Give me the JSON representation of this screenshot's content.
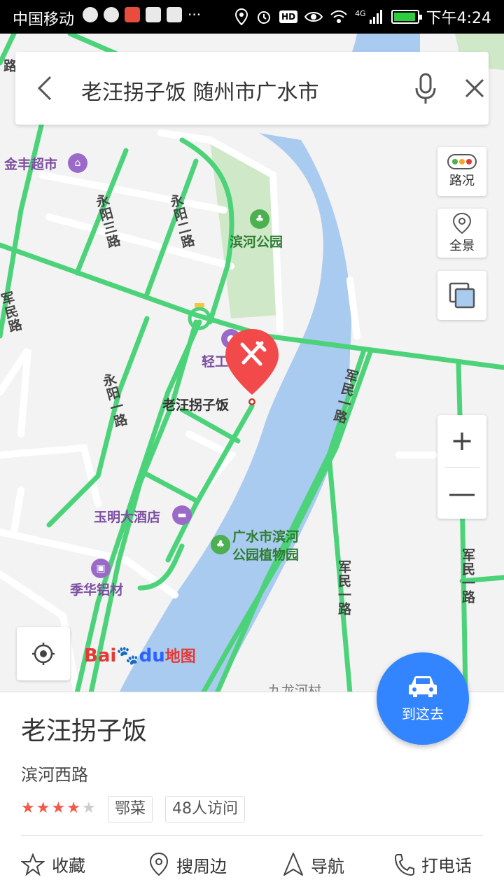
{
  "status_bar": {
    "carrier": "中国移动",
    "network": "4G",
    "hd": "HD",
    "time": "下午4:24",
    "more": "···"
  },
  "search": {
    "query": "老汪拐子饭 随州市广水市"
  },
  "map": {
    "labels": {
      "jinfeng": "金丰超市",
      "binhe_park": "滨河公园",
      "qinggong": "轻工",
      "yuming": "玉明大酒店",
      "guangshui_park_1": "广水市滨河",
      "guangshui_park_2": "公园植物园",
      "jihua": "季华铝材",
      "jiulong": "九龙河村",
      "marker_name": "老汪拐子饭"
    },
    "roads": {
      "yongyang_top": "永阳三路",
      "yongyang_2": "永阳二路",
      "yongyang_1": "永阳一路",
      "junmin_left": "军民路",
      "junmin_mid": "军民一路",
      "junmin_low": "军民一路",
      "junmin_right": "军民一路",
      "top_left": "路"
    },
    "colors": {
      "road": "#4cd37a",
      "water": "#a9cbef",
      "park": "#cfe9c8",
      "marker": "#f2494b"
    }
  },
  "controls": {
    "traffic": "路况",
    "panorama": "全景",
    "zoom_in": "+",
    "zoom_out": "—"
  },
  "logo": {
    "part1": "Bai",
    "part2": "du",
    "part3": "地图"
  },
  "go_button": {
    "label": "到这去"
  },
  "place": {
    "name": "老汪拐子饭",
    "address": "滨河西路",
    "rating": 4,
    "max_rating": 5,
    "cuisine": "鄂菜",
    "visits": "48人访问"
  },
  "actions": {
    "favorite": "收藏",
    "nearby": "搜周边",
    "navigate": "导航",
    "call": "打电话"
  }
}
